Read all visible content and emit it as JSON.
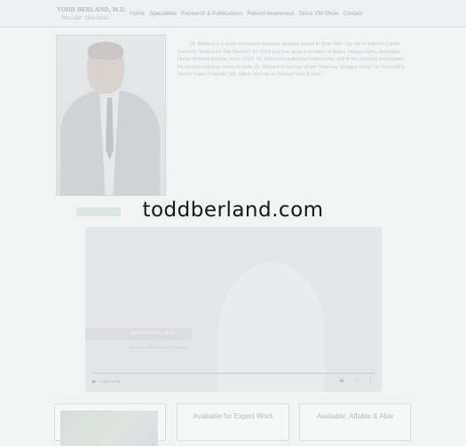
{
  "header": {
    "logo_name": "TODD BERLAND, M.D.",
    "logo_subtitle": "Vascular Specialist",
    "nav": [
      "Home",
      "Specialties",
      "Research & Publications",
      "Patient Awareness",
      "Sirius XM Show",
      "Contact"
    ]
  },
  "bio": {
    "paragraphs": [
      "Dr. Berland is a world renowned vascular surgeon based in New York City. He is listed in Castle Connolly \"America's Top Doctors\" for 2019 and has been a member of Alpha Omega Alpha, American Honor Medical Society, since 2003. Dr. Berland is published extensively and is the principal investigator for several ongoing research trials. Dr. Berland is co-host of the \"Vascular Surgery Show\" on SiriusXM's Doctor Radio Channel 110, which airs live on Fridays from 8-9am."
    ]
  },
  "watermark": "toddberland.com",
  "video": {
    "title": "Todd Berland, M.D.",
    "subtitle": "Board certified vascular specialist",
    "time": "0:00 / 1:00"
  },
  "cards": {
    "card2_label": "Available for Expert Work",
    "card3_label": "Available, Affable & Able"
  },
  "colors": {
    "watermark": "#151515",
    "background": "#f2f4f4"
  }
}
